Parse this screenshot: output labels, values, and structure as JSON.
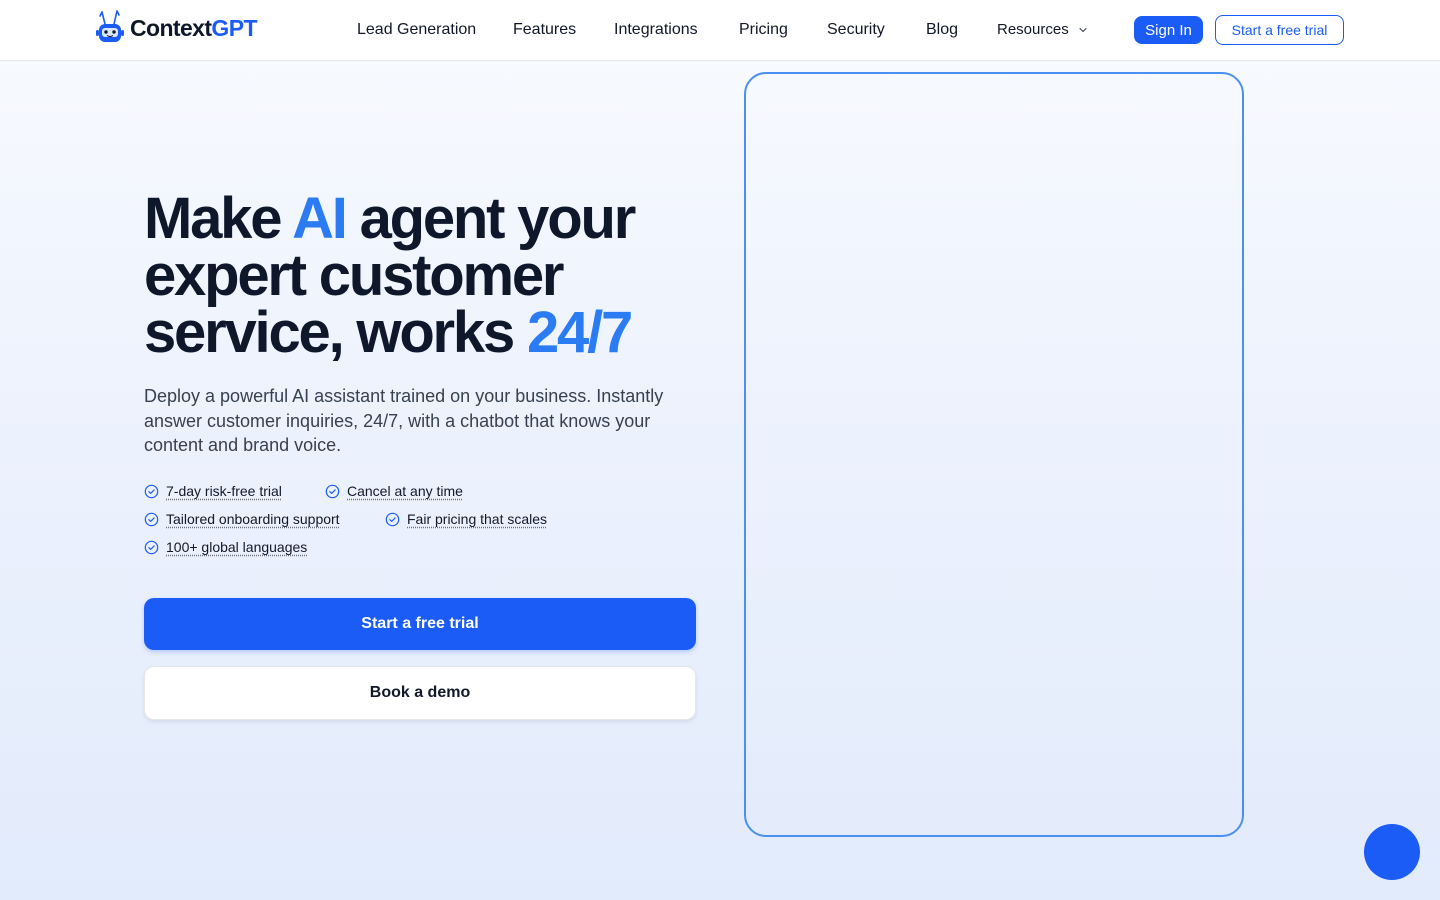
{
  "brand": {
    "name_main": "Context",
    "name_accent": "GPT",
    "logo_icon": "robot-bunny-logo"
  },
  "nav": {
    "items": [
      {
        "label": "Lead Generation"
      },
      {
        "label": "Features"
      },
      {
        "label": "Integrations"
      },
      {
        "label": "Pricing"
      },
      {
        "label": "Security"
      },
      {
        "label": "Blog"
      },
      {
        "label": "Resources",
        "icon": "chevron-down-icon"
      }
    ],
    "sign_in": "Sign In",
    "start_trial": "Start a free trial"
  },
  "hero": {
    "headline": {
      "part1": "Make ",
      "highlight1": "AI",
      "part2": " agent your expert customer service, works ",
      "highlight2": "24/7"
    },
    "subheadline": "Deploy a powerful AI assistant trained on your business. Instantly answer customer inquiries, 24/7, with a chatbot that knows your content and brand voice.",
    "features": [
      "7-day risk-free trial",
      "Cancel at any time",
      "Tailored onboarding support",
      "Fair pricing that scales",
      "100+ global languages"
    ],
    "primary_cta": "Start a free trial",
    "secondary_cta": "Book a demo"
  },
  "colors": {
    "brand_blue": "#1a5cf5",
    "highlight_blue": "#2b7cf3",
    "panel_border": "#4a90f0",
    "text_dark": "#0f172a"
  },
  "icons": {
    "feature_check": "check-circle-icon",
    "chat_launcher": "chat-launcher-icon"
  }
}
